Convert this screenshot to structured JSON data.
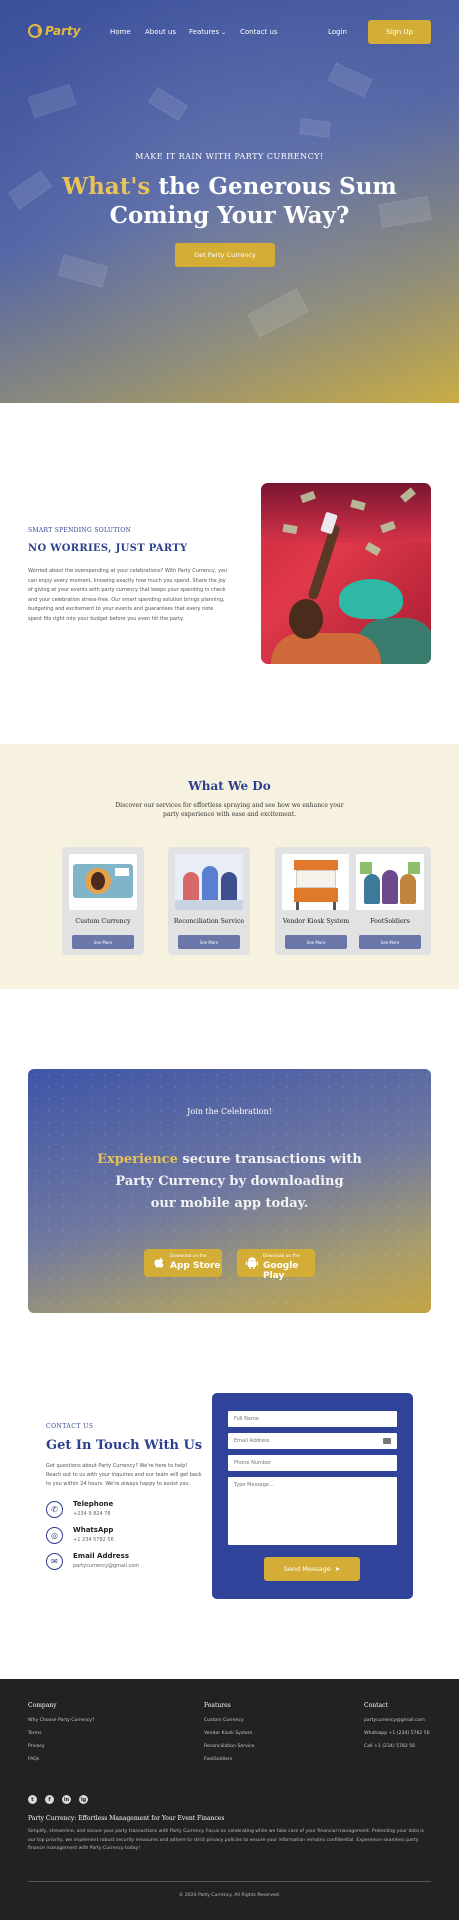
{
  "nav": {
    "logo_text": "Party",
    "links": [
      "Home",
      "About us",
      "Features",
      "Contact us"
    ],
    "login": "Login",
    "signup": "Sign Up"
  },
  "hero": {
    "eyebrow": "MAKE IT RAIN WITH PARTY CURRENCY!",
    "title_gold": "What's",
    "title_rest": "the Generous Sum",
    "title_line2": "Coming Your Way?",
    "cta": "Get Party Currency"
  },
  "intro": {
    "eyebrow": "SMART SPENDING SOLUTION",
    "title": "NO WORRIES, JUST PARTY",
    "body": "Worried about the overspending at your celebrations? With Party Currency, you can enjoy every moment, knowing exactly how much you spend. Share the joy of giving at your events with party currency that keeps your spending in check and your celebration stress-free. Our smart spending solution brings planning, budgeting and excitement to your events and guarantees that every note spent fits right into your budget before you even hit the party."
  },
  "services": {
    "title": "What We Do",
    "subtitle": "Discover our services for effortless spraying and see how we enhance your party experience with ease and excitement.",
    "cards": [
      {
        "title": "Custom Currency",
        "button": "See More"
      },
      {
        "title": "Reconciliation Service",
        "button": "See More"
      },
      {
        "title": "Vendor Kiosk System",
        "button": "See More"
      },
      {
        "title": "FootSoldiers",
        "button": "See More"
      }
    ]
  },
  "app": {
    "eyebrow": "Join the Celebration!",
    "title_gold": "Experience",
    "title_rest": "secure transactions with",
    "title_line2": "Party Currency by downloading",
    "title_line3": "our mobile app today.",
    "appstore_small": "Download on the",
    "appstore_big": "App Store",
    "play_small": "Download on the",
    "play_big": "Google Play"
  },
  "contact": {
    "eyebrow": "CONTACT US",
    "title": "Get In Touch With Us",
    "body": "Got questions about Party Currency? We're here to help! Reach out to us with your inquiries and our team will get back to you within 24 hours. We're always happy to assist you.",
    "items": [
      {
        "label": "Telephone",
        "value": "+234 9 824 78"
      },
      {
        "label": "WhatsApp",
        "value": "+1 234 5782 56"
      },
      {
        "label": "Email Address",
        "value": "partycurrency@gmail.com"
      }
    ],
    "form": {
      "name_placeholder": "Full Name",
      "email_placeholder": "Email Address",
      "phone_placeholder": "Phone Number",
      "message_placeholder": "Type Message...",
      "send": "Send Message"
    }
  },
  "footer": {
    "col1_title": "Company",
    "col1_links": [
      "Why Choose Party Currency?",
      "Terms",
      "Privacy",
      "FAQs"
    ],
    "col2_title": "Features",
    "col2_links": [
      "Custom Currency",
      "Vendor Kiosk System",
      "Reconciliation Service",
      "FootSoldiers"
    ],
    "col3_title": "Contact",
    "col3_links": [
      "partycurrency@gmail.com",
      "Whatsapp +1 (234) 5782 56",
      "Call +1 (234) 5782 56"
    ],
    "social": [
      "t",
      "f",
      "in",
      "ig"
    ],
    "tagline": "Party Currency: Effortless Management for Your Event Finances",
    "description": "Simplify, streamline, and secure your party transactions with Party Currency. Focus on celebrating while we take care of your financial management. Protecting your data is our top priority, we implement robust security measures and adhere to strict privacy policies to ensure your information remains confidential. Experience seamless party finance management with Party Currency today!",
    "copyright": "© 2024 Party Currency. All Rights Reserved."
  },
  "colors": {
    "brand_blue": "#2d3f8f",
    "brand_gold": "#d4ad37",
    "footer_bg": "#222222",
    "services_bg": "#f7f1df"
  }
}
